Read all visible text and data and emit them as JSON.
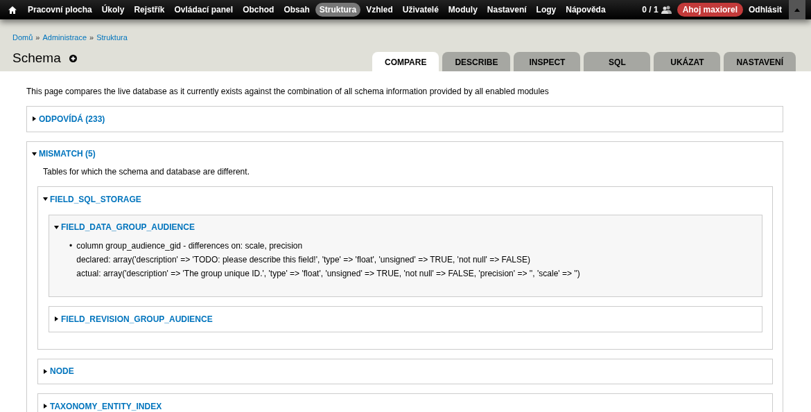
{
  "toolbar": {
    "menu": [
      {
        "label": "Pracovní plocha",
        "selected": false
      },
      {
        "label": "Úkoly",
        "selected": false
      },
      {
        "label": "Rejstřík",
        "selected": false
      },
      {
        "label": "Ovládací panel",
        "selected": false
      },
      {
        "label": "Obchod",
        "selected": false
      },
      {
        "label": "Obsah",
        "selected": false
      },
      {
        "label": "Struktura",
        "selected": true
      },
      {
        "label": "Vzhled",
        "selected": false
      },
      {
        "label": "Uživatelé",
        "selected": false
      },
      {
        "label": "Moduly",
        "selected": false
      },
      {
        "label": "Nastavení",
        "selected": false
      },
      {
        "label": "Logy",
        "selected": false
      },
      {
        "label": "Nápověda",
        "selected": false
      }
    ],
    "user_count": "0 / 1",
    "greeting": "Ahoj maxiorel",
    "logout": "Odhlásit"
  },
  "breadcrumb": [
    "Domů",
    "Administrace",
    "Struktura"
  ],
  "breadcrumb_separator": "»",
  "page_title": "Schema",
  "tabs": [
    {
      "label": "COMPARE",
      "selected": true
    },
    {
      "label": "DESCRIBE",
      "selected": false
    },
    {
      "label": "INSPECT",
      "selected": false
    },
    {
      "label": "SQL",
      "selected": false
    },
    {
      "label": "UKÁZAT",
      "selected": false
    },
    {
      "label": "NASTAVENÍ",
      "selected": false
    }
  ],
  "intro": "This page compares the live database as it currently exists against the combination of all schema information provided by all enabled modules",
  "sections": [
    {
      "title": "ODPOVÍDÁ (233)",
      "expanded": false
    },
    {
      "title": "MISMATCH (5)",
      "expanded": true,
      "description": "Tables for which the schema and database are different.",
      "children": [
        {
          "title": "FIELD_SQL_STORAGE",
          "expanded": true,
          "children": [
            {
              "title": "FIELD_DATA_GROUP_AUDIENCE",
              "expanded": true,
              "items": [
                {
                  "bullet": "•",
                  "summary": "column group_audience_gid - differences on: scale, precision",
                  "declared": "declared: array('description' => 'TODO: please describe this field!', 'type' => 'float', 'unsigned' => TRUE, 'not null' => FALSE)",
                  "actual": "actual: array('description' => 'The group unique ID.', 'type' => 'float', 'unsigned' => TRUE, 'not null' => FALSE, 'precision' => '', 'scale' => '')"
                }
              ]
            },
            {
              "title": "FIELD_REVISION_GROUP_AUDIENCE",
              "expanded": false
            }
          ]
        },
        {
          "title": "NODE",
          "expanded": false
        },
        {
          "title": "TAXONOMY_ENTITY_INDEX",
          "expanded": false
        }
      ]
    }
  ]
}
